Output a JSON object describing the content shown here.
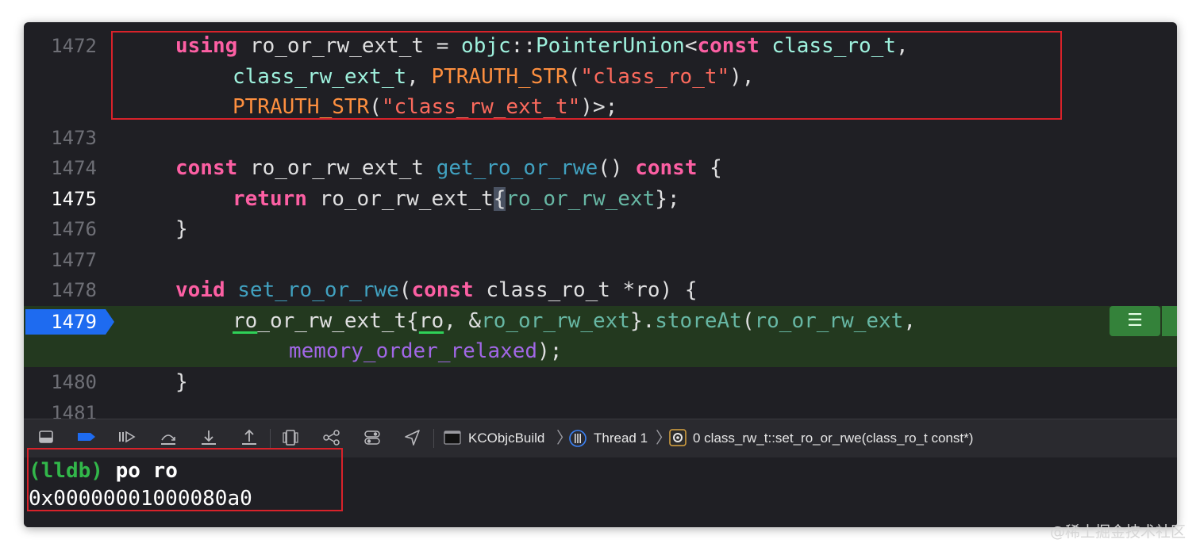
{
  "editor": {
    "lines": [
      {
        "number": "1472",
        "text": "using ro_or_rw_ext_t = objc::PointerUnion<const class_ro_t,"
      },
      {
        "number": "",
        "text": "class_rw_ext_t, PTRAUTH_STR(\"class_ro_t\"),"
      },
      {
        "number": "",
        "text": "PTRAUTH_STR(\"class_rw_ext_t\")>;"
      },
      {
        "number": "1473",
        "text": ""
      },
      {
        "number": "1474",
        "text": "const ro_or_rw_ext_t get_ro_or_rwe() const {"
      },
      {
        "number": "1475",
        "text": "return ro_or_rw_ext_t{ro_or_rw_ext};"
      },
      {
        "number": "1476",
        "text": "}"
      },
      {
        "number": "1477",
        "text": ""
      },
      {
        "number": "1478",
        "text": "void set_ro_or_rwe(const class_ro_t *ro) {"
      },
      {
        "number": "1479",
        "text": "ro_or_rw_ext_t{ro, &ro_or_rw_ext}.storeAt(ro_or_rw_ext,"
      },
      {
        "number": "",
        "text": "memory_order_relaxed);"
      },
      {
        "number": "1480",
        "text": "}"
      },
      {
        "number": "1481",
        "text": ""
      }
    ],
    "current_line": "1475",
    "pc_line": "1479",
    "annotation_icon": "list-icon"
  },
  "debug_bar": {
    "icons": [
      "console-toggle-icon",
      "breakpoint-toggle-icon",
      "continue-icon",
      "step-over-icon",
      "step-into-icon",
      "step-out-icon",
      "view-hierarchy-icon",
      "memory-graph-icon",
      "environment-overrides-icon",
      "location-icon"
    ],
    "breadcrumb": {
      "target": "KCObjcBuild",
      "thread": "Thread 1",
      "frame": "0 class_rw_t::set_ro_or_rwe(class_ro_t const*)"
    }
  },
  "console": {
    "prompt": "(lldb)",
    "command": "po ro",
    "output": "0x00000001000080a0"
  },
  "watermark": "@稀土掘金技术社区",
  "colors": {
    "editor_background": "#1f1f24",
    "keyword": "#fc5fa3",
    "type": "#9ef1dd",
    "macro": "#fd8f3f",
    "string": "#fc6a5d",
    "execution_highlight": "#23391f",
    "pc_marker": "#1e6bf0",
    "lldb_prompt": "#32b74a",
    "annotation_box": "#d8222a"
  }
}
